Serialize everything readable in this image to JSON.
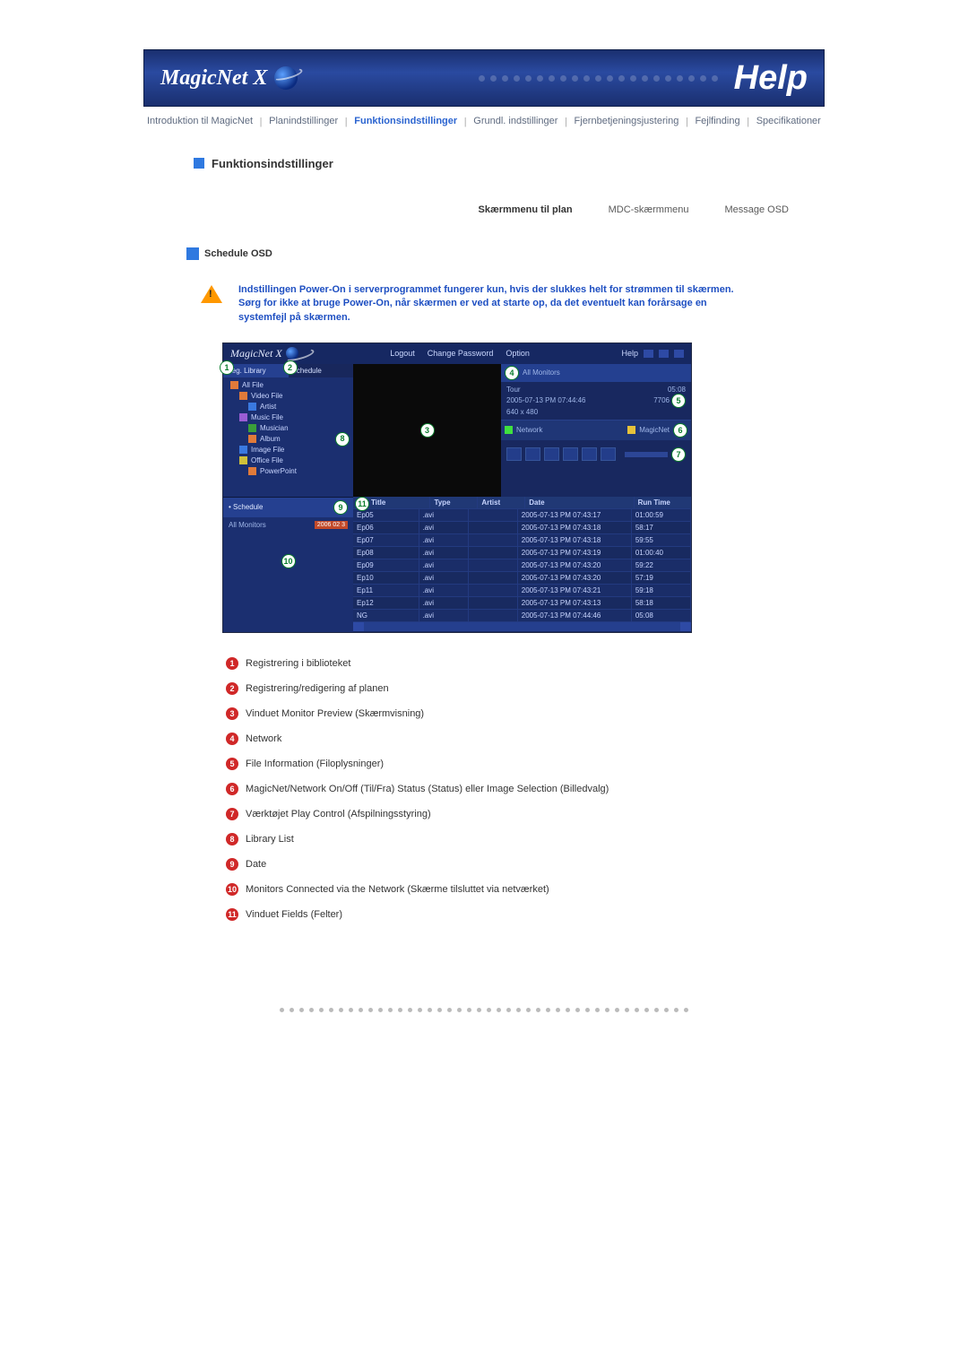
{
  "banner": {
    "brand": "MagicNet X",
    "help": "Help"
  },
  "nav": {
    "items": [
      "Introduktion til MagicNet",
      "Planindstillinger",
      "Funktionsindstillinger",
      "Grundl. indstillinger",
      "Fjernbetjeningsjustering",
      "Fejlfinding",
      "Specifikationer"
    ]
  },
  "section": {
    "title": "Funktionsindstillinger"
  },
  "tabs": {
    "t1": "Skærmmenu til plan",
    "t2": "MDC-skærmmenu",
    "t3": "Message OSD"
  },
  "subsection": {
    "title": "Schedule OSD"
  },
  "warning": "Indstillingen Power-On i serverprogrammet fungerer kun, hvis der slukkes helt for strømmen til skærmen. Sørg for ikke at bruge Power-On, når skærmen er ved at starte op, da det eventuelt kan forårsage en systemfejl på skærmen.",
  "app": {
    "brand": "MagicNet X",
    "menu": {
      "logout": "Logout",
      "changepw": "Change Password",
      "option": "Option",
      "help": "Help"
    },
    "left_tabs": {
      "lib": "Reg. Library",
      "sched": "Schedule"
    },
    "tree": {
      "all": "All File",
      "video": "Video File",
      "artist": "Artist",
      "music": "Music File",
      "musician": "Musician",
      "album": "Album",
      "image": "Image File",
      "office": "Office File",
      "ppt": "PowerPoint"
    },
    "right": {
      "monitors": "All Monitors",
      "tour": "Tour",
      "datetime": "2005-07-13 PM 07:44:46",
      "res": "640 x 480",
      "dur": "05:08",
      "size": "7706",
      "network": "Network",
      "magicnet": "MagicNet"
    },
    "bl": {
      "title": "Schedule",
      "all": "All Monitors",
      "date": "2006 02 3"
    },
    "grid": {
      "headers": {
        "title": "Title",
        "type": "Type",
        "artist": "Artist",
        "date": "Date",
        "run": "Run Time"
      },
      "rows": [
        {
          "title": "Ep05",
          "type": ".avi",
          "artist": "",
          "date": "2005-07-13 PM 07:43:17",
          "run": "01:00:59"
        },
        {
          "title": "Ep06",
          "type": ".avi",
          "artist": "",
          "date": "2005-07-13 PM 07:43:18",
          "run": "58:17"
        },
        {
          "title": "Ep07",
          "type": ".avi",
          "artist": "",
          "date": "2005-07-13 PM 07:43:18",
          "run": "59:55"
        },
        {
          "title": "Ep08",
          "type": ".avi",
          "artist": "",
          "date": "2005-07-13 PM 07:43:19",
          "run": "01:00:40"
        },
        {
          "title": "Ep09",
          "type": ".avi",
          "artist": "",
          "date": "2005-07-13 PM 07:43:20",
          "run": "59:22"
        },
        {
          "title": "Ep10",
          "type": ".avi",
          "artist": "",
          "date": "2005-07-13 PM 07:43:20",
          "run": "57:19"
        },
        {
          "title": "Ep11",
          "type": ".avi",
          "artist": "",
          "date": "2005-07-13 PM 07:43:21",
          "run": "59:18"
        },
        {
          "title": "Ep12",
          "type": ".avi",
          "artist": "",
          "date": "2005-07-13 PM 07:43:13",
          "run": "58:18"
        },
        {
          "title": "NG",
          "type": ".avi",
          "artist": "",
          "date": "2005-07-13 PM 07:44:46",
          "run": "05:08"
        }
      ]
    }
  },
  "legend": {
    "i1": "Registrering i biblioteket",
    "i2": "Registrering/redigering af planen",
    "i3": "Vinduet Monitor Preview (Skærmvisning)",
    "i4": "Network",
    "i5": "File Information (Filoplysninger)",
    "i6": "MagicNet/Network On/Off (Til/Fra) Status (Status) eller Image Selection (Billedvalg)",
    "i7": "Værktøjet Play Control (Afspilningsstyring)",
    "i8": "Library List",
    "i9": "Date",
    "i10": "Monitors Connected via the Network (Skærme tilsluttet via netværket)",
    "i11": "Vinduet Fields (Felter)"
  }
}
